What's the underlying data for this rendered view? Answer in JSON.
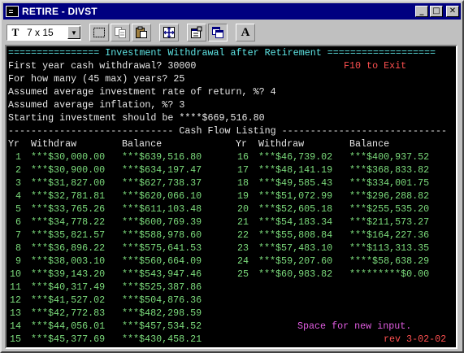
{
  "window": {
    "title": "RETIRE - DIVST",
    "minimize_glyph": "_",
    "maximize_glyph": "□",
    "close_glyph": "✕"
  },
  "toolbar": {
    "font_icon_glyph": "T",
    "font_size_value": "7 x 15",
    "dropdown_glyph": "▼",
    "bold_glyph": "A",
    "tools": [
      "mark-icon",
      "copy-icon",
      "paste-icon",
      "fullscreen-icon",
      "properties-icon",
      "background-icon",
      "font-icon"
    ]
  },
  "console": {
    "header_line": "================ Investment Withdrawal after Retirement ===================",
    "q1": "First year cash withdrawal? 30000",
    "exit_hint": "F10 to Exit",
    "q2": "For how many (45 max) years? 25",
    "q3": "Assumed average investment rate of return, %? 4",
    "q4": "Assumed average inflation, %? 3",
    "start_inv": "Starting investment should be ****$669,516.80",
    "listing_line": "----------------------------- Cash Flow Listing -----------------------------",
    "col_yr": "Yr",
    "col_withdraw": "Withdraw",
    "col_balance": "Balance",
    "rows_left": [
      {
        "yr": "1",
        "withdraw": "***$30,000.00",
        "balance": "***$639,516.80"
      },
      {
        "yr": "2",
        "withdraw": "***$30,900.00",
        "balance": "***$634,197.47"
      },
      {
        "yr": "3",
        "withdraw": "***$31,827.00",
        "balance": "***$627,738.37"
      },
      {
        "yr": "4",
        "withdraw": "***$32,781.81",
        "balance": "***$620,066.10"
      },
      {
        "yr": "5",
        "withdraw": "***$33,765.26",
        "balance": "***$611,103.48"
      },
      {
        "yr": "6",
        "withdraw": "***$34,778.22",
        "balance": "***$600,769.39"
      },
      {
        "yr": "7",
        "withdraw": "***$35,821.57",
        "balance": "***$588,978.60"
      },
      {
        "yr": "8",
        "withdraw": "***$36,896.22",
        "balance": "***$575,641.53"
      },
      {
        "yr": "9",
        "withdraw": "***$38,003.10",
        "balance": "***$560,664.09"
      },
      {
        "yr": "10",
        "withdraw": "***$39,143.20",
        "balance": "***$543,947.46"
      },
      {
        "yr": "11",
        "withdraw": "***$40,317.49",
        "balance": "***$525,387.86"
      },
      {
        "yr": "12",
        "withdraw": "***$41,527.02",
        "balance": "***$504,876.36"
      },
      {
        "yr": "13",
        "withdraw": "***$42,772.83",
        "balance": "***$482,298.59"
      },
      {
        "yr": "14",
        "withdraw": "***$44,056.01",
        "balance": "***$457,534.52"
      },
      {
        "yr": "15",
        "withdraw": "***$45,377.69",
        "balance": "***$430,458.21"
      }
    ],
    "rows_right": [
      {
        "yr": "16",
        "withdraw": "***$46,739.02",
        "balance": "***$400,937.52"
      },
      {
        "yr": "17",
        "withdraw": "***$48,141.19",
        "balance": "***$368,833.82"
      },
      {
        "yr": "18",
        "withdraw": "***$49,585.43",
        "balance": "***$334,001.75"
      },
      {
        "yr": "19",
        "withdraw": "***$51,072.99",
        "balance": "***$296,288.82"
      },
      {
        "yr": "20",
        "withdraw": "***$52,605.18",
        "balance": "***$255,535.20"
      },
      {
        "yr": "21",
        "withdraw": "***$54,183.34",
        "balance": "***$211,573.27"
      },
      {
        "yr": "22",
        "withdraw": "***$55,808.84",
        "balance": "***$164,227.36"
      },
      {
        "yr": "23",
        "withdraw": "***$57,483.10",
        "balance": "***$113,313.35"
      },
      {
        "yr": "24",
        "withdraw": "***$59,207.60",
        "balance": "****$58,638.29"
      },
      {
        "yr": "25",
        "withdraw": "***$60,983.82",
        "balance": "*********$0.00"
      }
    ],
    "space_hint": "Space for new input.",
    "revision": "rev 3-02-02"
  }
}
